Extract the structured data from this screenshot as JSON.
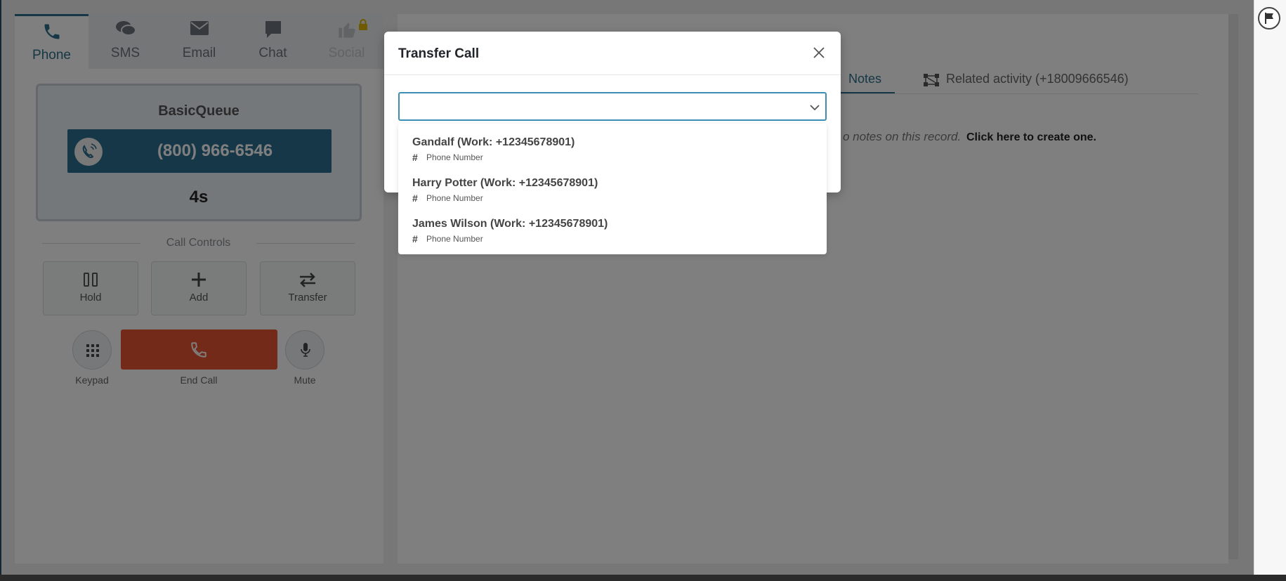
{
  "tabs": [
    {
      "label": "Phone",
      "icon": "phone-icon",
      "state": "active"
    },
    {
      "label": "SMS",
      "icon": "chat-bubbles-icon",
      "state": "normal"
    },
    {
      "label": "Email",
      "icon": "envelope-icon",
      "state": "normal"
    },
    {
      "label": "Chat",
      "icon": "chat-icon",
      "state": "normal"
    },
    {
      "label": "Social",
      "icon": "thumbs-up-icon",
      "state": "disabled"
    }
  ],
  "call": {
    "queue": "BasicQueue",
    "number": "(800) 966-6546",
    "duration": "4s"
  },
  "controls": {
    "section_label": "Call Controls",
    "hold": "Hold",
    "add": "Add",
    "transfer": "Transfer",
    "keypad": "Keypad",
    "end_call": "End Call",
    "mute": "Mute"
  },
  "record": {
    "notes_tab": "Notes",
    "related_tab": "Related activity (+18009666546)",
    "notes_empty_fragment": "o notes on this record.",
    "create_link": "Click here to create one."
  },
  "modal": {
    "title": "Transfer Call",
    "select_value": "",
    "options": [
      {
        "title": "Gandalf (Work: +12345678901)",
        "subtitle": "Phone Number"
      },
      {
        "title": "Harry Potter (Work: +12345678901)",
        "subtitle": "Phone Number"
      },
      {
        "title": "James Wilson (Work: +12345678901)",
        "subtitle": "Phone Number"
      }
    ]
  },
  "colors": {
    "accent": "#2c6e8a",
    "number_bar": "#2a6f8e",
    "end_call": "#e85530",
    "focus_border": "#3d8fb3"
  }
}
